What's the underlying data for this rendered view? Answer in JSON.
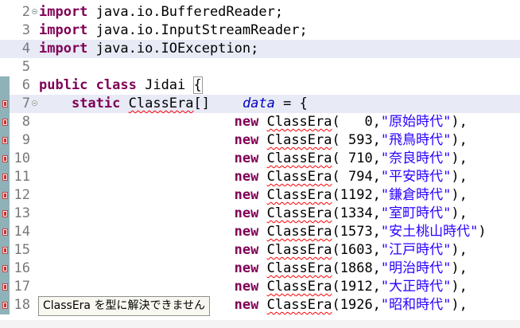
{
  "editor": {
    "lines": [
      {
        "num": "2",
        "tokens": [
          {
            "t": "import",
            "c": "kw"
          },
          {
            "t": " java.io.BufferedReader;"
          }
        ]
      },
      {
        "num": "3",
        "tokens": [
          {
            "t": "import",
            "c": "kw"
          },
          {
            "t": " java.io.InputStreamReader;"
          }
        ]
      },
      {
        "num": "4",
        "tokens": [
          {
            "t": "import",
            "c": "kw"
          },
          {
            "t": " java.io.IOException;"
          }
        ]
      },
      {
        "num": "5",
        "tokens": []
      },
      {
        "num": "6",
        "tokens": [
          {
            "t": "public",
            "c": "kw"
          },
          {
            "t": " "
          },
          {
            "t": "class",
            "c": "kw"
          },
          {
            "t": " Jidai "
          },
          {
            "t": "{",
            "c": "brace"
          }
        ]
      },
      {
        "num": "7",
        "tokens": [
          {
            "t": "    "
          },
          {
            "t": "static",
            "c": "kw"
          },
          {
            "t": " "
          },
          {
            "t": "ClassEra",
            "c": "err"
          },
          {
            "t": "[]    "
          },
          {
            "t": "data",
            "c": "field"
          },
          {
            "t": " = {"
          }
        ]
      },
      {
        "num": "8",
        "tokens": [
          {
            "t": "                        "
          },
          {
            "t": "new",
            "c": "kw"
          },
          {
            "t": " "
          },
          {
            "t": "ClassEra",
            "c": "err"
          },
          {
            "t": "(   0,"
          },
          {
            "t": "\"原始時代\"",
            "c": "str"
          },
          {
            "t": "),"
          }
        ]
      },
      {
        "num": "9",
        "tokens": [
          {
            "t": "                        "
          },
          {
            "t": "new",
            "c": "kw"
          },
          {
            "t": " "
          },
          {
            "t": "ClassEra",
            "c": "err"
          },
          {
            "t": "( 593,"
          },
          {
            "t": "\"飛鳥時代\"",
            "c": "str"
          },
          {
            "t": "),"
          }
        ]
      },
      {
        "num": "10",
        "tokens": [
          {
            "t": "                        "
          },
          {
            "t": "new",
            "c": "kw"
          },
          {
            "t": " "
          },
          {
            "t": "ClassEra",
            "c": "err"
          },
          {
            "t": "( 710,"
          },
          {
            "t": "\"奈良時代\"",
            "c": "str"
          },
          {
            "t": "),"
          }
        ]
      },
      {
        "num": "11",
        "tokens": [
          {
            "t": "                        "
          },
          {
            "t": "new",
            "c": "kw"
          },
          {
            "t": " "
          },
          {
            "t": "ClassEra",
            "c": "err"
          },
          {
            "t": "( 794,"
          },
          {
            "t": "\"平安時代\"",
            "c": "str"
          },
          {
            "t": "),"
          }
        ]
      },
      {
        "num": "12",
        "tokens": [
          {
            "t": "                        "
          },
          {
            "t": "new",
            "c": "kw"
          },
          {
            "t": " "
          },
          {
            "t": "ClassEra",
            "c": "err"
          },
          {
            "t": "(1192,"
          },
          {
            "t": "\"鎌倉時代\"",
            "c": "str"
          },
          {
            "t": "),"
          }
        ]
      },
      {
        "num": "13",
        "tokens": [
          {
            "t": "                        "
          },
          {
            "t": "new",
            "c": "kw"
          },
          {
            "t": " "
          },
          {
            "t": "ClassEra",
            "c": "err"
          },
          {
            "t": "(1334,"
          },
          {
            "t": "\"室町時代\"",
            "c": "str"
          },
          {
            "t": "),"
          }
        ]
      },
      {
        "num": "14",
        "tokens": [
          {
            "t": "                        "
          },
          {
            "t": "new",
            "c": "kw"
          },
          {
            "t": " "
          },
          {
            "t": "ClassEra",
            "c": "err"
          },
          {
            "t": "(1573,"
          },
          {
            "t": "\"安土桃山時代\"",
            "c": "str"
          },
          {
            "t": ")"
          }
        ]
      },
      {
        "num": "15",
        "tokens": [
          {
            "t": "                        "
          },
          {
            "t": "new",
            "c": "kw"
          },
          {
            "t": " "
          },
          {
            "t": "ClassEra",
            "c": "err"
          },
          {
            "t": "(1603,"
          },
          {
            "t": "\"江戸時代\"",
            "c": "str"
          },
          {
            "t": "),"
          }
        ]
      },
      {
        "num": "16",
        "tokens": [
          {
            "t": "                        "
          },
          {
            "t": "new",
            "c": "kw"
          },
          {
            "t": " "
          },
          {
            "t": "ClassEra",
            "c": "err"
          },
          {
            "t": "(1868,"
          },
          {
            "t": "\"明治時代\"",
            "c": "str"
          },
          {
            "t": "),"
          }
        ]
      },
      {
        "num": "17",
        "tokens": [
          {
            "t": "                        "
          },
          {
            "t": "new",
            "c": "kw"
          },
          {
            "t": " "
          },
          {
            "t": "ClassEra",
            "c": "err"
          },
          {
            "t": "(1912,"
          },
          {
            "t": "\"大正時代\"",
            "c": "str"
          },
          {
            "t": "),"
          }
        ]
      },
      {
        "num": "18",
        "tokens": [
          {
            "t": "                        "
          },
          {
            "t": "new",
            "c": "kw"
          },
          {
            "t": " "
          },
          {
            "t": "ClassEra",
            "c": "err"
          },
          {
            "t": "(1926,"
          },
          {
            "t": "\"昭和時代\"",
            "c": "str"
          },
          {
            "t": "),"
          }
        ]
      }
    ],
    "highlighted_lines": [
      "4",
      "7"
    ],
    "error_lines": [
      "7",
      "8",
      "9",
      "10",
      "11",
      "12",
      "13",
      "14",
      "15",
      "16",
      "17",
      "18"
    ],
    "changed_lines": [
      "6",
      "7",
      "8",
      "9",
      "10",
      "11",
      "12",
      "13",
      "14",
      "15",
      "16",
      "17",
      "18"
    ],
    "fold_lines": [
      "2",
      "7"
    ],
    "colors": {
      "keyword": "#7f0055",
      "string": "#2a00ff",
      "field": "#0000c0",
      "error": "#ff0000",
      "line_number": "#787878"
    }
  },
  "tooltip": {
    "text": "ClassEra を型に解決できません"
  }
}
